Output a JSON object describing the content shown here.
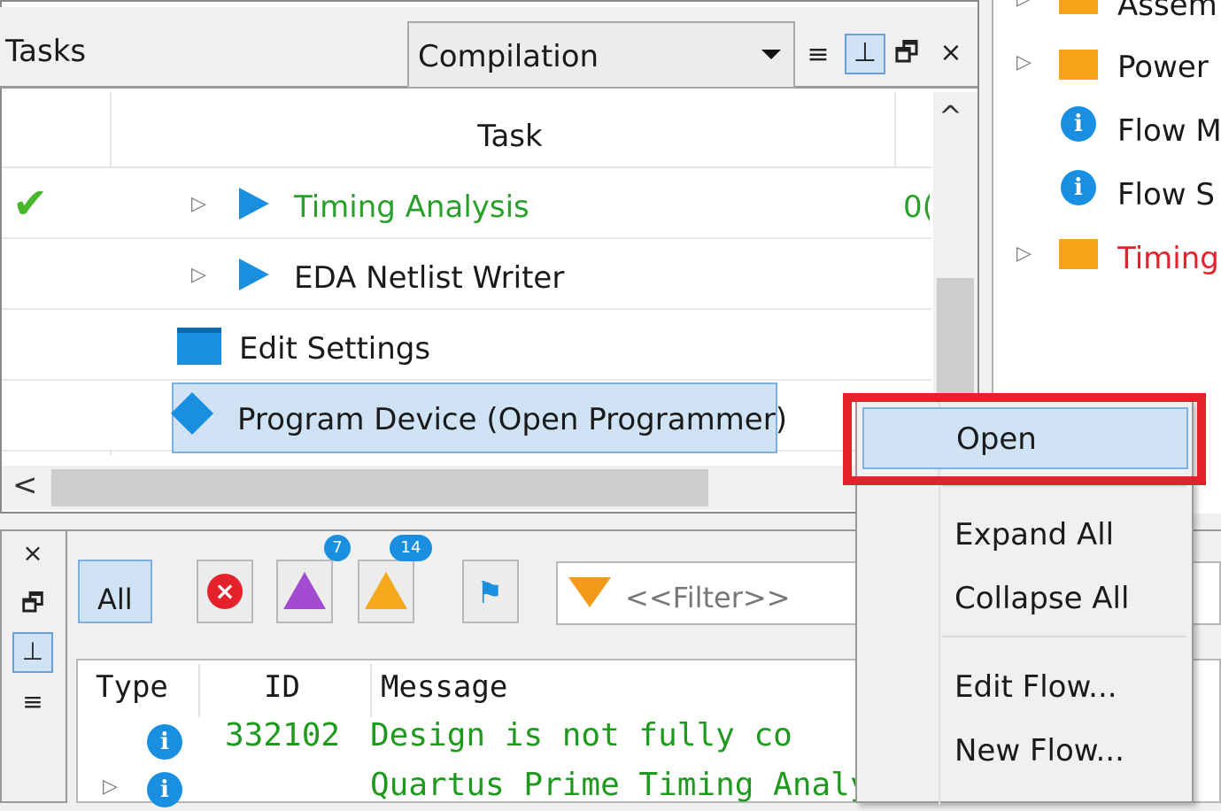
{
  "tasks_panel": {
    "title": "Tasks",
    "flow_select_value": "Compilation",
    "column_task": "Task",
    "rows": [
      {
        "label": "Timing Analysis",
        "status_text": "0("
      },
      {
        "label": "EDA Netlist Writer"
      },
      {
        "label": "Edit Settings"
      },
      {
        "label": "Program Device (Open Programmer)"
      }
    ],
    "up_arrow": "^",
    "left_arrow": "<"
  },
  "tree_panel": {
    "items": [
      "Assem",
      "Power .",
      "Flow M",
      "Flow S",
      "Timing"
    ]
  },
  "messages_panel": {
    "all_label": "All",
    "filter_placeholder": "<<Filter>>",
    "badge_1": "7",
    "badge_2": "14",
    "columns": {
      "type": "Type",
      "id": "ID",
      "message": "Message"
    },
    "rows": [
      {
        "id": "332102",
        "message": "Design is not fully co"
      },
      {
        "id": "",
        "message": "Quartus Prime Timing Analyzer was succe"
      }
    ]
  },
  "context_menu": {
    "open": "Open",
    "expand_all": "Expand All",
    "collapse_all": "Collapse All",
    "edit_flow": "Edit Flow...",
    "new_flow": "New Flow..."
  },
  "icons": {
    "close": "×",
    "float": "🗗",
    "pin": "⊥",
    "menu": "≡",
    "info": "i",
    "check": "✔",
    "expander": "▷"
  },
  "colors": {
    "accent_blue": "#1a8fe0",
    "success_green": "#46b62a",
    "error_red": "#e4222b",
    "folder_orange": "#f7a318",
    "selection": "#cfe3f5"
  }
}
